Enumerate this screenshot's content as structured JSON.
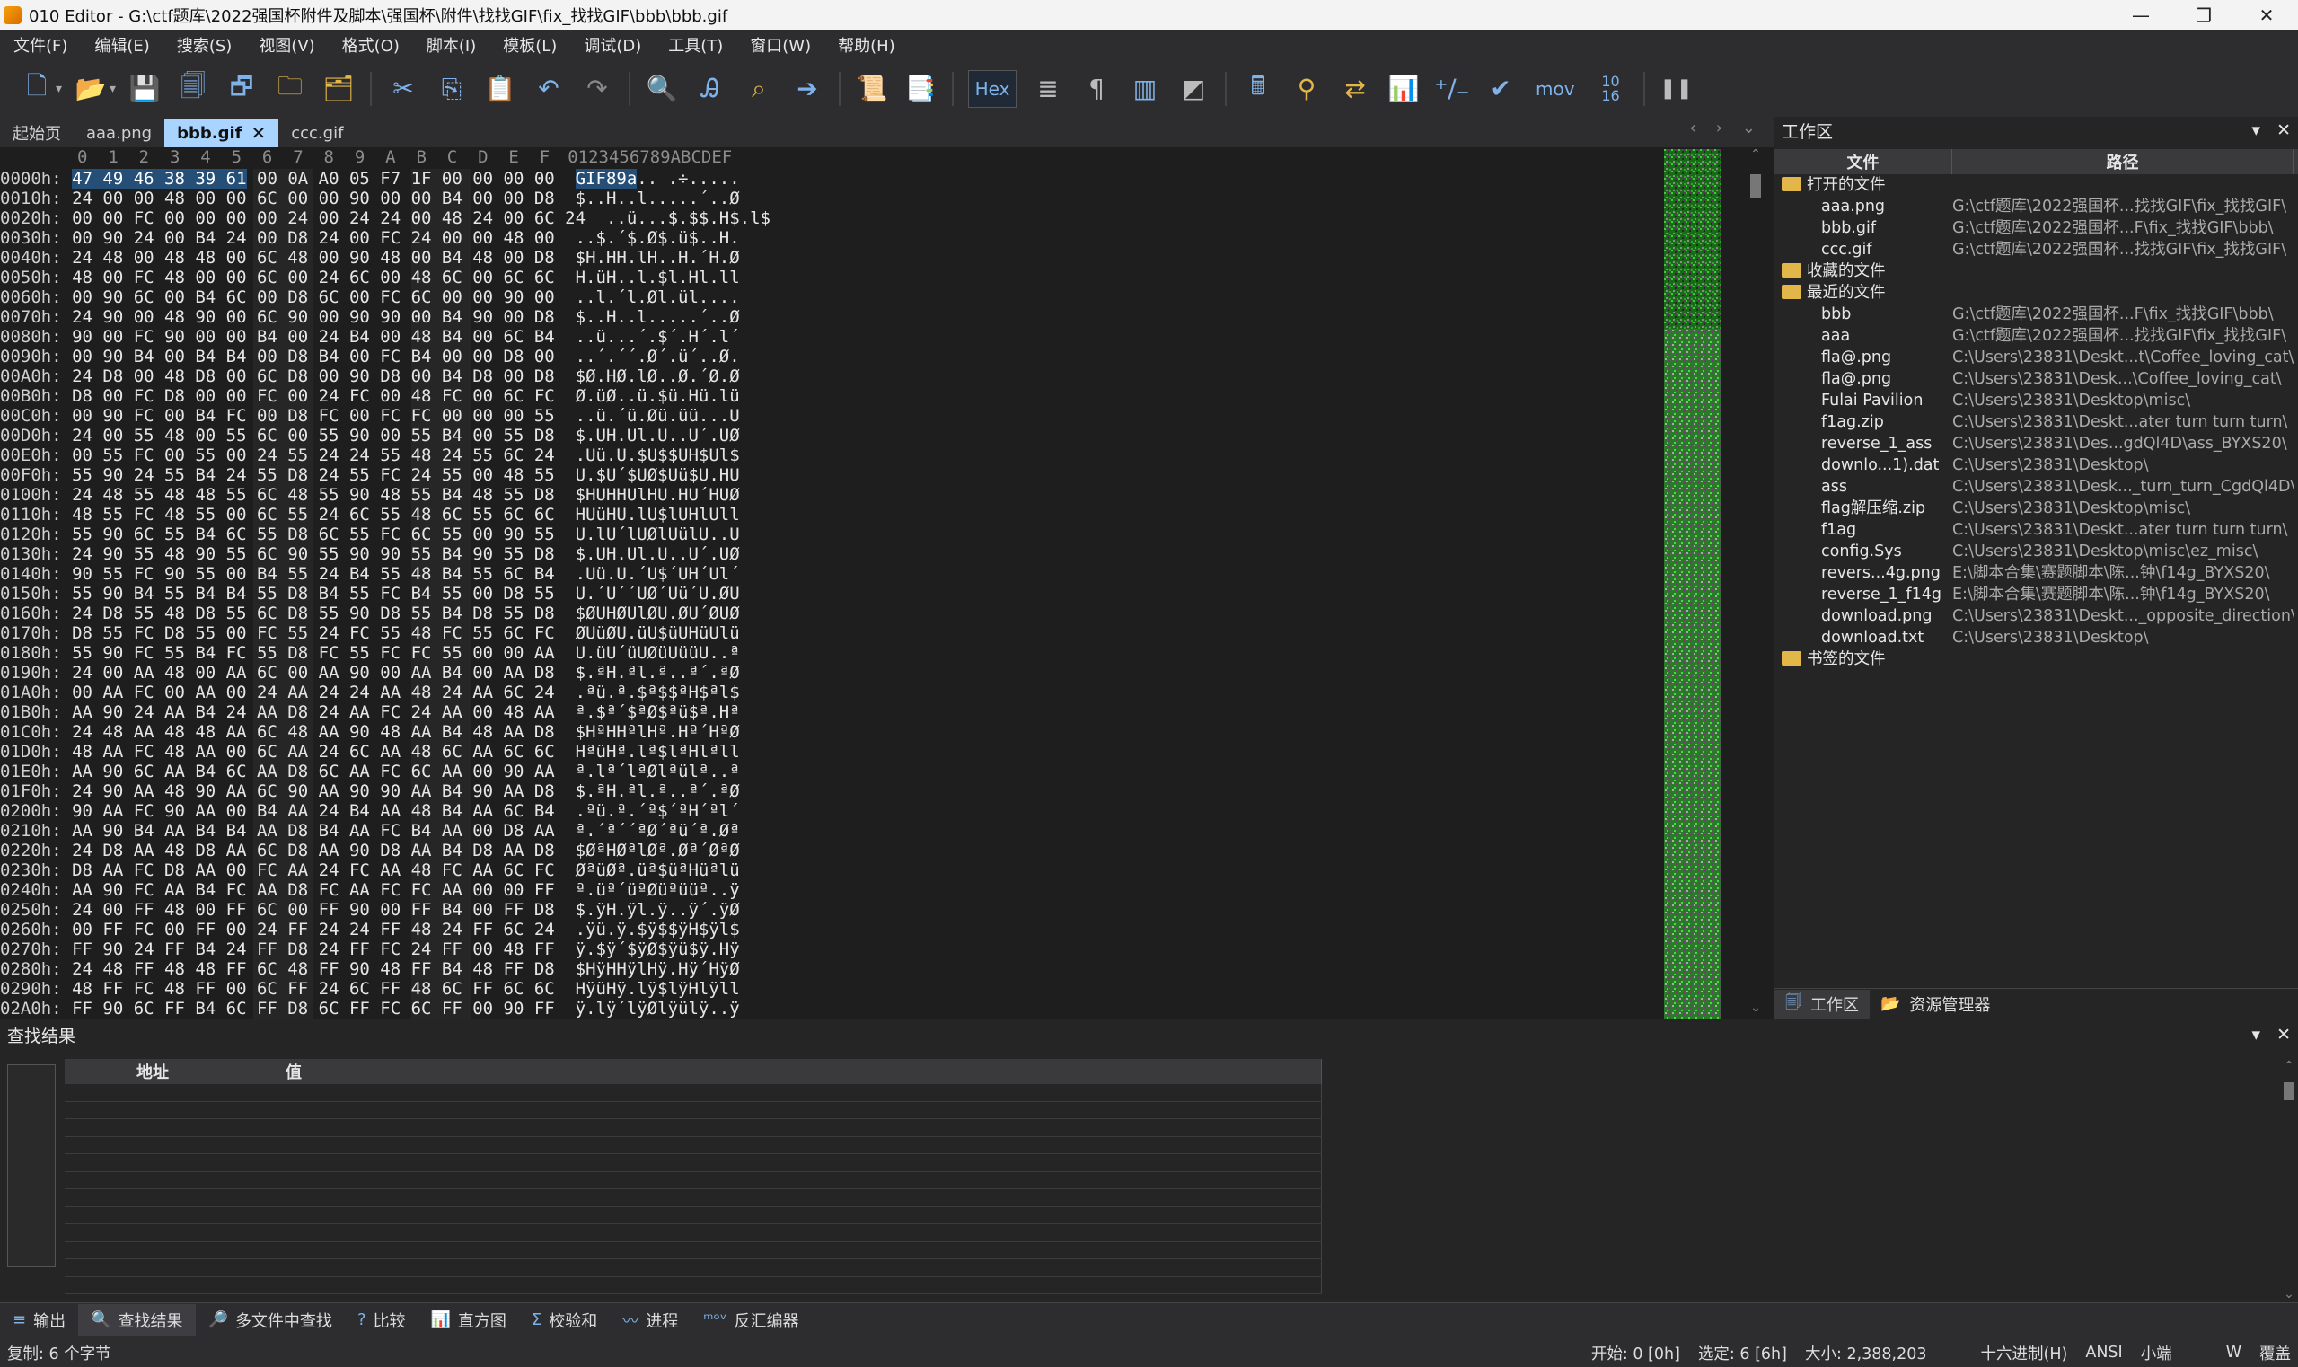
{
  "window": {
    "title": "010 Editor - G:\\ctf题库\\2022强国杯附件及脚本\\强国杯\\附件\\找找GIF\\fix_找找GIF\\bbb\\bbb.gif",
    "minimize": "—",
    "maximize": "❐",
    "close": "✕"
  },
  "menu": [
    "文件(F)",
    "编辑(E)",
    "搜索(S)",
    "视图(V)",
    "格式(O)",
    "脚本(I)",
    "模板(L)",
    "调试(D)",
    "工具(T)",
    "窗口(W)",
    "帮助(H)"
  ],
  "toolbar": {
    "hex_label": "Hex",
    "mov_label": "mov",
    "num_label": "10 16"
  },
  "tabs": [
    {
      "label": "起始页",
      "active": false
    },
    {
      "label": "aaa.png",
      "active": false
    },
    {
      "label": "bbb.gif",
      "active": true
    },
    {
      "label": "ccc.gif",
      "active": false
    }
  ],
  "tab_close": "✕",
  "hex": {
    "header_cols": "0  1  2  3  4  5  6  7  8  9  A  B  C  D  E  F",
    "header_ascii": "0123456789ABCDEF",
    "rows": [
      {
        "addr": "0000h:",
        "hex": "47 49 46 38 39 61 00 0A A0 05 F7 1F 00 00 00 00",
        "ascii": "GIF89a.. .÷.....",
        "sel": 6
      },
      {
        "addr": "0010h:",
        "hex": "24 00 00 48 00 00 6C 00 00 90 00 00 B4 00 00 D8",
        "ascii": "$..H..l.....´..Ø"
      },
      {
        "addr": "0020h:",
        "hex": "00 00 FC 00 00 00 00 24 00 24 24 00 48 24 00 6C 24",
        "ascii": "..ü...$.$$.H$.l$"
      },
      {
        "addr": "0030h:",
        "hex": "00 90 24 00 B4 24 00 D8 24 00 FC 24 00 00 48 00",
        "ascii": "..$.´$.Ø$.ü$..H."
      },
      {
        "addr": "0040h:",
        "hex": "24 48 00 48 48 00 6C 48 00 90 48 00 B4 48 00 D8",
        "ascii": "$H.HH.lH..H.´H.Ø"
      },
      {
        "addr": "0050h:",
        "hex": "48 00 FC 48 00 00 6C 00 24 6C 00 48 6C 00 6C 6C",
        "ascii": "H.üH..l.$l.Hl.ll"
      },
      {
        "addr": "0060h:",
        "hex": "00 90 6C 00 B4 6C 00 D8 6C 00 FC 6C 00 00 90 00",
        "ascii": "..l.´l.Øl.ül...."
      },
      {
        "addr": "0070h:",
        "hex": "24 90 00 48 90 00 6C 90 00 90 90 00 B4 90 00 D8",
        "ascii": "$..H..l.....´..Ø"
      },
      {
        "addr": "0080h:",
        "hex": "90 00 FC 90 00 00 B4 00 24 B4 00 48 B4 00 6C B4",
        "ascii": "..ü...´.$´.H´.l´"
      },
      {
        "addr": "0090h:",
        "hex": "00 90 B4 00 B4 B4 00 D8 B4 00 FC B4 00 00 D8 00",
        "ascii": "..´.´´.Ø´.ü´..Ø."
      },
      {
        "addr": "00A0h:",
        "hex": "24 D8 00 48 D8 00 6C D8 00 90 D8 00 B4 D8 00 D8",
        "ascii": "$Ø.HØ.lØ..Ø.´Ø.Ø"
      },
      {
        "addr": "00B0h:",
        "hex": "D8 00 FC D8 00 00 FC 00 24 FC 00 48 FC 00 6C FC",
        "ascii": "Ø.üØ..ü.$ü.Hü.lü"
      },
      {
        "addr": "00C0h:",
        "hex": "00 90 FC 00 B4 FC 00 D8 FC 00 FC FC 00 00 00 55",
        "ascii": "..ü.´ü.Øü.üü...U"
      },
      {
        "addr": "00D0h:",
        "hex": "24 00 55 48 00 55 6C 00 55 90 00 55 B4 00 55 D8",
        "ascii": "$.UH.Ul.U..U´.UØ"
      },
      {
        "addr": "00E0h:",
        "hex": "00 55 FC 00 55 00 24 55 24 24 55 48 24 55 6C 24",
        "ascii": ".Uü.U.$U$$UH$Ul$"
      },
      {
        "addr": "00F0h:",
        "hex": "55 90 24 55 B4 24 55 D8 24 55 FC 24 55 00 48 55",
        "ascii": "U.$U´$UØ$Uü$U.HU"
      },
      {
        "addr": "0100h:",
        "hex": "24 48 55 48 48 55 6C 48 55 90 48 55 B4 48 55 D8",
        "ascii": "$HUHHUlHU.HU´HUØ"
      },
      {
        "addr": "0110h:",
        "hex": "48 55 FC 48 55 00 6C 55 24 6C 55 48 6C 55 6C 6C",
        "ascii": "HUüHU.lU$lUHlUll"
      },
      {
        "addr": "0120h:",
        "hex": "55 90 6C 55 B4 6C 55 D8 6C 55 FC 6C 55 00 90 55",
        "ascii": "U.lU´lUØlUülU..U"
      },
      {
        "addr": "0130h:",
        "hex": "24 90 55 48 90 55 6C 90 55 90 90 55 B4 90 55 D8",
        "ascii": "$.UH.Ul.U..U´.UØ"
      },
      {
        "addr": "0140h:",
        "hex": "90 55 FC 90 55 00 B4 55 24 B4 55 48 B4 55 6C B4",
        "ascii": ".Uü.U.´U$´UH´Ul´"
      },
      {
        "addr": "0150h:",
        "hex": "55 90 B4 55 B4 B4 55 D8 B4 55 FC B4 55 00 D8 55",
        "ascii": "U.´U´´UØ´Uü´U.ØU"
      },
      {
        "addr": "0160h:",
        "hex": "24 D8 55 48 D8 55 6C D8 55 90 D8 55 B4 D8 55 D8",
        "ascii": "$ØUHØUlØU.ØU´ØUØ"
      },
      {
        "addr": "0170h:",
        "hex": "D8 55 FC D8 55 00 FC 55 24 FC 55 48 FC 55 6C FC",
        "ascii": "ØUüØU.üU$üUHüUlü"
      },
      {
        "addr": "0180h:",
        "hex": "55 90 FC 55 B4 FC 55 D8 FC 55 FC FC 55 00 00 AA",
        "ascii": "U.üU´üUØüUüüU..ª"
      },
      {
        "addr": "0190h:",
        "hex": "24 00 AA 48 00 AA 6C 00 AA 90 00 AA B4 00 AA D8",
        "ascii": "$.ªH.ªl.ª..ª´.ªØ"
      },
      {
        "addr": "01A0h:",
        "hex": "00 AA FC 00 AA 00 24 AA 24 24 AA 48 24 AA 6C 24",
        "ascii": ".ªü.ª.$ª$$ªH$ªl$"
      },
      {
        "addr": "01B0h:",
        "hex": "AA 90 24 AA B4 24 AA D8 24 AA FC 24 AA 00 48 AA",
        "ascii": "ª.$ª´$ªØ$ªü$ª.Hª"
      },
      {
        "addr": "01C0h:",
        "hex": "24 48 AA 48 48 AA 6C 48 AA 90 48 AA B4 48 AA D8",
        "ascii": "$HªHHªlHª.Hª´HªØ"
      },
      {
        "addr": "01D0h:",
        "hex": "48 AA FC 48 AA 00 6C AA 24 6C AA 48 6C AA 6C 6C",
        "ascii": "HªüHª.lª$lªHlªll"
      },
      {
        "addr": "01E0h:",
        "hex": "AA 90 6C AA B4 6C AA D8 6C AA FC 6C AA 00 90 AA",
        "ascii": "ª.lª´lªØlªülª..ª"
      },
      {
        "addr": "01F0h:",
        "hex": "24 90 AA 48 90 AA 6C 90 AA 90 90 AA B4 90 AA D8",
        "ascii": "$.ªH.ªl.ª..ª´.ªØ"
      },
      {
        "addr": "0200h:",
        "hex": "90 AA FC 90 AA 00 B4 AA 24 B4 AA 48 B4 AA 6C B4",
        "ascii": ".ªü.ª.´ª$´ªH´ªl´"
      },
      {
        "addr": "0210h:",
        "hex": "AA 90 B4 AA B4 B4 AA D8 B4 AA FC B4 AA 00 D8 AA",
        "ascii": "ª.´ª´´ªØ´ªü´ª.Øª"
      },
      {
        "addr": "0220h:",
        "hex": "24 D8 AA 48 D8 AA 6C D8 AA 90 D8 AA B4 D8 AA D8",
        "ascii": "$ØªHØªlØª.Øª´ØªØ"
      },
      {
        "addr": "0230h:",
        "hex": "D8 AA FC D8 AA 00 FC AA 24 FC AA 48 FC AA 6C FC",
        "ascii": "ØªüØª.üª$üªHüªlü"
      },
      {
        "addr": "0240h:",
        "hex": "AA 90 FC AA B4 FC AA D8 FC AA FC FC AA 00 00 FF",
        "ascii": "ª.üª´üªØüªüüª..ÿ"
      },
      {
        "addr": "0250h:",
        "hex": "24 00 FF 48 00 FF 6C 00 FF 90 00 FF B4 00 FF D8",
        "ascii": "$.ÿH.ÿl.ÿ..ÿ´.ÿØ"
      },
      {
        "addr": "0260h:",
        "hex": "00 FF FC 00 FF 00 24 FF 24 24 FF 48 24 FF 6C 24",
        "ascii": ".ÿü.ÿ.$ÿ$$ÿH$ÿl$"
      },
      {
        "addr": "0270h:",
        "hex": "FF 90 24 FF B4 24 FF D8 24 FF FC 24 FF 00 48 FF",
        "ascii": "ÿ.$ÿ´$ÿØ$ÿü$ÿ.Hÿ"
      },
      {
        "addr": "0280h:",
        "hex": "24 48 FF 48 48 FF 6C 48 FF 90 48 FF B4 48 FF D8",
        "ascii": "$HÿHHÿlHÿ.Hÿ´HÿØ"
      },
      {
        "addr": "0290h:",
        "hex": "48 FF FC 48 FF 00 6C FF 24 6C FF 48 6C FF 6C 6C",
        "ascii": "HÿüHÿ.lÿ$lÿHlÿll"
      },
      {
        "addr": "02A0h:",
        "hex": "FF 90 6C FF B4 6C FF D8 6C FF FC 6C FF 00 90 FF",
        "ascii": "ÿ.lÿ´lÿØlÿülÿ..ÿ"
      }
    ]
  },
  "workspace": {
    "title": "工作区",
    "col_file": "文件",
    "col_path": "路径",
    "groups": [
      {
        "label": "打开的文件",
        "items": [
          {
            "name": "aaa.png",
            "path": "G:\\ctf题库\\2022强国杯...找找GIF\\fix_找找GIF\\"
          },
          {
            "name": "bbb.gif",
            "path": "G:\\ctf题库\\2022强国杯...F\\fix_找找GIF\\bbb\\"
          },
          {
            "name": "ccc.gif",
            "path": "G:\\ctf题库\\2022强国杯...找找GIF\\fix_找找GIF\\"
          }
        ]
      },
      {
        "label": "收藏的文件",
        "items": []
      },
      {
        "label": "最近的文件",
        "items": [
          {
            "name": "bbb",
            "path": "G:\\ctf题库\\2022强国杯...F\\fix_找找GIF\\bbb\\"
          },
          {
            "name": "aaa",
            "path": "G:\\ctf题库\\2022强国杯...找找GIF\\fix_找找GIF\\"
          },
          {
            "name": "fla@.png",
            "path": "C:\\Users\\23831\\Deskt...t\\Coffee_loving_cat\\"
          },
          {
            "name": "fla@.png",
            "path": "C:\\Users\\23831\\Desk...\\Coffee_loving_cat\\"
          },
          {
            "name": "Fulai Pavilion",
            "path": "C:\\Users\\23831\\Desktop\\misc\\"
          },
          {
            "name": "f1ag.zip",
            "path": "C:\\Users\\23831\\Deskt...ater turn turn turn\\"
          },
          {
            "name": "reverse_1_ass",
            "path": "C:\\Users\\23831\\Des...gdQl4D\\ass_BYXS20\\"
          },
          {
            "name": "downlo...1).dat",
            "path": "C:\\Users\\23831\\Desktop\\"
          },
          {
            "name": "ass",
            "path": "C:\\Users\\23831\\Desk..._turn_turn_CgdQl4D\\"
          },
          {
            "name": "flag解压缩.zip",
            "path": "C:\\Users\\23831\\Desktop\\misc\\"
          },
          {
            "name": "f1ag",
            "path": "C:\\Users\\23831\\Deskt...ater turn turn turn\\"
          },
          {
            "name": "config.Sys",
            "path": "C:\\Users\\23831\\Desktop\\misc\\ez_misc\\"
          },
          {
            "name": "revers...4g.png",
            "path": "E:\\脚本合集\\赛题脚本\\陈...钟\\f14g_BYXS20\\"
          },
          {
            "name": "reverse_1_f14g",
            "path": "E:\\脚本合集\\赛题脚本\\陈...钟\\f14g_BYXS20\\"
          },
          {
            "name": "download.png",
            "path": "C:\\Users\\23831\\Deskt..._opposite_direction\\"
          },
          {
            "name": "download.txt",
            "path": "C:\\Users\\23831\\Desktop\\"
          }
        ]
      },
      {
        "label": "书签的文件",
        "items": []
      }
    ],
    "tabs": [
      "工作区",
      "资源管理器"
    ]
  },
  "results": {
    "title": "查找结果",
    "col_addr": "地址",
    "col_value": "值"
  },
  "bottom_tabs": [
    {
      "label": "输出",
      "active": false
    },
    {
      "label": "查找结果",
      "active": true
    },
    {
      "label": "多文件中查找",
      "active": false
    },
    {
      "label": "比较",
      "active": false
    },
    {
      "label": "直方图",
      "active": false
    },
    {
      "label": "校验和",
      "active": false
    },
    {
      "label": "进程",
      "active": false
    },
    {
      "label": "反汇编器",
      "active": false
    }
  ],
  "status": {
    "left": "复制: 6 个字节",
    "start": "开始: 0 [0h]",
    "selected": "选定: 6 [6h]",
    "size": "大小: 2,388,203",
    "mode": "十六进制(H)",
    "encoding": "ANSI",
    "endian": "小端",
    "w": "W",
    "overwrite": "覆盖"
  }
}
